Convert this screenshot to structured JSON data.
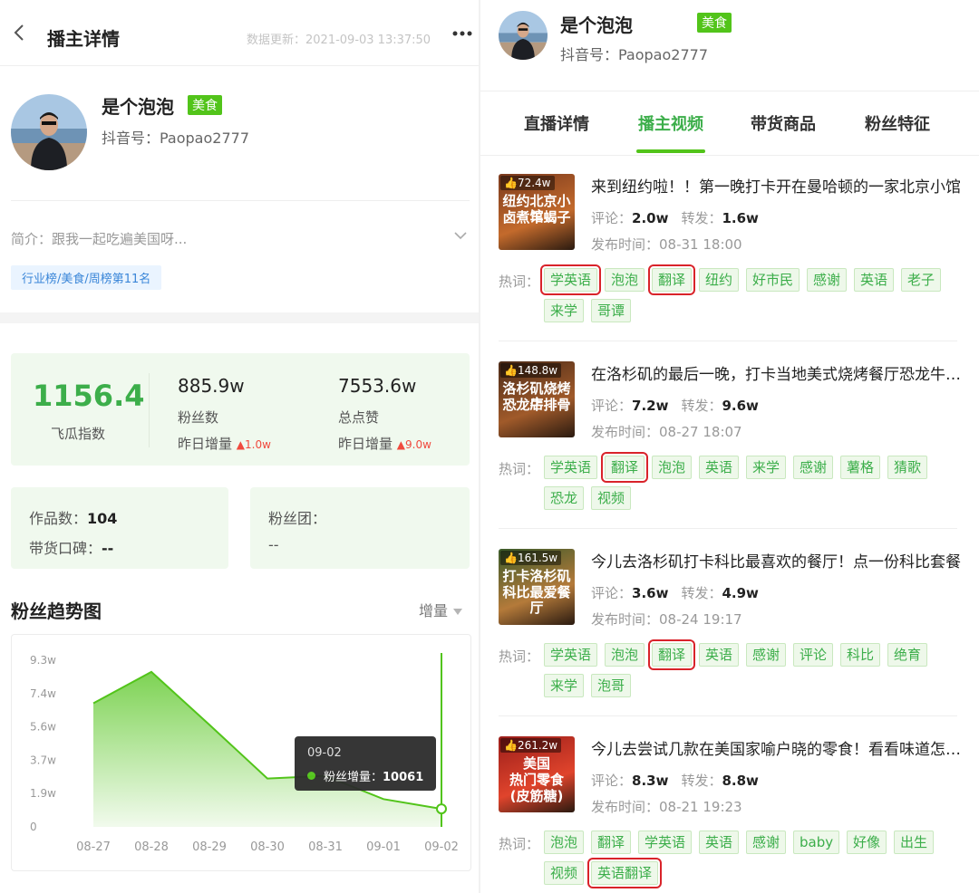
{
  "left": {
    "page_title": "播主详情",
    "update_time": "数据更新：2021-09-03 13:37:50",
    "profile": {
      "name": "是个泡泡",
      "category": "美食",
      "douyin_id": "抖音号：Paopao2777"
    },
    "intro": "简介：跟我一起吃遍美国呀...",
    "rank_tag": "行业榜/美食/周榜第11名",
    "stats": {
      "index_value": "1156.4",
      "index_label": "飞瓜指数",
      "fans_value": "885.9w",
      "fans_label": "粉丝数",
      "fans_delta_label": "昨日增量",
      "fans_delta": "▲1.0w",
      "likes_value": "7553.6w",
      "likes_label": "总点赞",
      "likes_delta_label": "昨日增量",
      "likes_delta": "▲9.0w"
    },
    "info": {
      "works_label": "作品数：",
      "works_value": "104",
      "praise_label": "带货口碑：",
      "praise_value": "--",
      "fanclub_label": "粉丝团：",
      "fanclub_value": "--"
    },
    "trend": {
      "title": "粉丝趋势图",
      "mode": "增量"
    },
    "tooltip": {
      "date": "09-02",
      "label": "粉丝增量：",
      "value": "10061"
    }
  },
  "chart_data": {
    "type": "area",
    "title": "粉丝趋势图",
    "categories": [
      "08-27",
      "08-28",
      "08-29",
      "08-30",
      "08-31",
      "09-01",
      "09-02"
    ],
    "y_ticks": [
      "0",
      "1.9w",
      "3.7w",
      "5.6w",
      "7.4w",
      "9.3w"
    ],
    "y_tick_values": [
      0,
      18600,
      37200,
      55800,
      74400,
      93000
    ],
    "ylim": [
      0,
      93000
    ],
    "series": [
      {
        "name": "粉丝增量",
        "values": [
          69000,
          86500,
          57000,
          27000,
          28500,
          15500,
          10061
        ]
      }
    ],
    "grid": false,
    "color": "#52c41a"
  },
  "right": {
    "profile": {
      "name": "是个泡泡",
      "category": "美食",
      "douyin_id": "抖音号：Paopao2777"
    },
    "tabs": [
      "直播详情",
      "播主视频",
      "带货商品",
      "粉丝特征"
    ],
    "active_tab": 1,
    "labels": {
      "comments": "评论：",
      "shares": "转发：",
      "publish": "发布时间：",
      "hot": "热词："
    },
    "videos": [
      {
        "likes": "72.4w",
        "thumb_text": [
          "纽约北京小馆",
          "卤煮羊蝎子"
        ],
        "title": "来到纽约啦！！第一晚打卡开在曼哈顿的一家北京小馆",
        "comments": "2.0w",
        "shares": "1.6w",
        "time": "08-31 18:00",
        "tags": [
          "学英语",
          "泡泡",
          "翻译",
          "纽约",
          "好市民",
          "感谢",
          "英语",
          "老子",
          "来学",
          "哥谭"
        ],
        "highlight": [
          0,
          2
        ]
      },
      {
        "likes": "148.8w",
        "thumb_text": [
          "洛杉矶烧烤店",
          "恐龙牛排骨"
        ],
        "title": "在洛杉矶的最后一晚，打卡当地美式烧烤餐厅恐龙牛排骨",
        "comments": "7.2w",
        "shares": "9.6w",
        "time": "08-27 18:07",
        "tags": [
          "学英语",
          "翻译",
          "泡泡",
          "英语",
          "来学",
          "感谢",
          "薯格",
          "猜歌",
          "恐龙",
          "视频"
        ],
        "highlight": [
          1
        ]
      },
      {
        "likes": "161.5w",
        "thumb_text": [
          "打卡洛杉矶",
          "科比最爱餐厅"
        ],
        "title": "今儿去洛杉矶打卡科比最喜欢的餐厅！点一份科比套餐",
        "comments": "3.6w",
        "shares": "4.9w",
        "time": "08-24 19:17",
        "tags": [
          "学英语",
          "泡泡",
          "翻译",
          "英语",
          "感谢",
          "评论",
          "科比",
          "绝育",
          "来学",
          "泡哥"
        ],
        "highlight": [
          2
        ]
      },
      {
        "likes": "261.2w",
        "thumb_text": [
          "美国",
          "热门零食",
          "(皮筋糖)"
        ],
        "title": "今儿去尝试几款在美国家喻户晓的零食！看看味道怎么样",
        "comments": "8.3w",
        "shares": "8.8w",
        "time": "08-21 19:23",
        "tags": [
          "泡泡",
          "翻译",
          "学英语",
          "英语",
          "感谢",
          "baby",
          "好像",
          "出生",
          "视频",
          "英语翻译"
        ],
        "highlight": [
          9
        ]
      }
    ]
  }
}
